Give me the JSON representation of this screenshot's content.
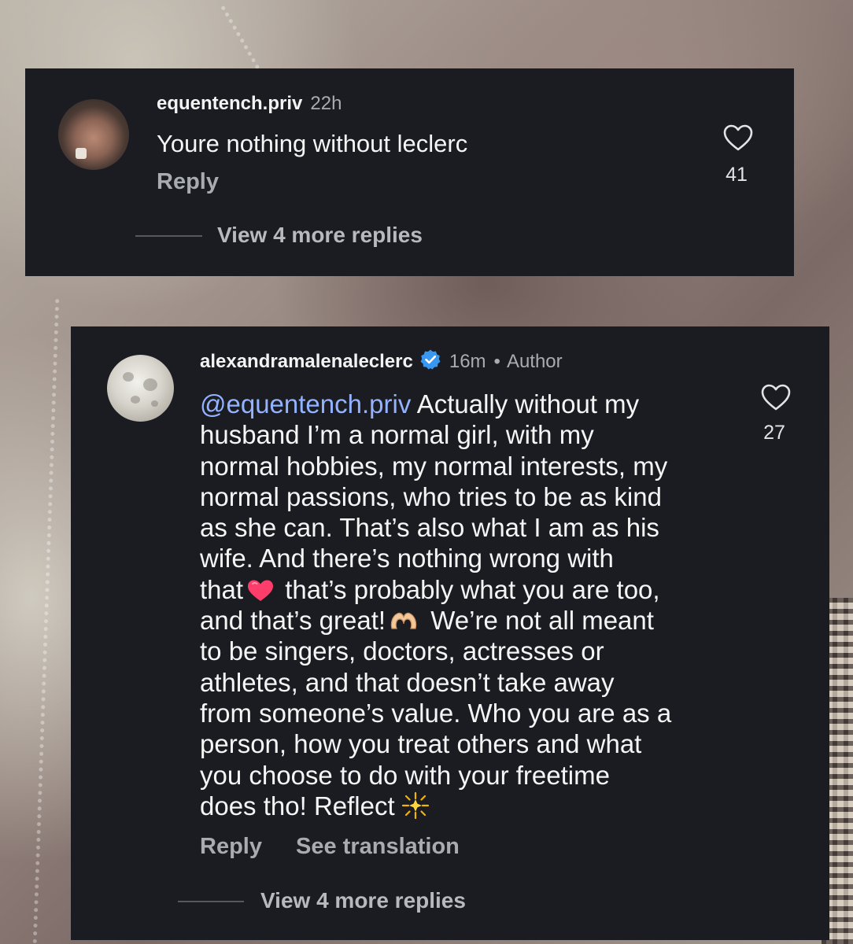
{
  "comments": [
    {
      "username": "equentench.priv",
      "time": "22h",
      "text": "Youre nothing without leclerc",
      "reply_label": "Reply",
      "likes": "41",
      "view_replies": "View 4 more replies",
      "avatar_icon": "user-photo-avatar"
    },
    {
      "username": "alexandramalenaleclerc",
      "verified": true,
      "time": "16m",
      "separator": "•",
      "author_badge": "Author",
      "mention": "@equentench.priv",
      "lines": [
        " Actually without my",
        "husband I’m a normal girl, with my",
        "normal hobbies, my normal interests, my",
        "normal passions, who tries to be as kind",
        "as she can. That’s also what I am as his",
        "wife. And there’s nothing wrong with",
        "that",
        " that’s probably what you are too,",
        "and that’s great!",
        " We’re not all meant",
        "to be singers, doctors, actresses or",
        "athletes, and that doesn’t take away",
        "from someone’s value. Who you are as a",
        "person, how you treat others and what",
        "you choose to do with your freetime",
        "does tho! Reflect"
      ],
      "reply_label": "Reply",
      "translate_label": "See translation",
      "likes": "27",
      "view_replies": "View 4 more replies",
      "avatar_icon": "moon-avatar",
      "emojis": [
        "red-heart-emoji",
        "heart-hands-emoji",
        "sparkle-star-emoji"
      ]
    }
  ],
  "colors": {
    "card_bg": "#1a1c21",
    "text_primary": "#f5f5f5",
    "text_secondary": "#a8abb0",
    "mention": "#93b2ff",
    "verified": "#3897f0"
  }
}
